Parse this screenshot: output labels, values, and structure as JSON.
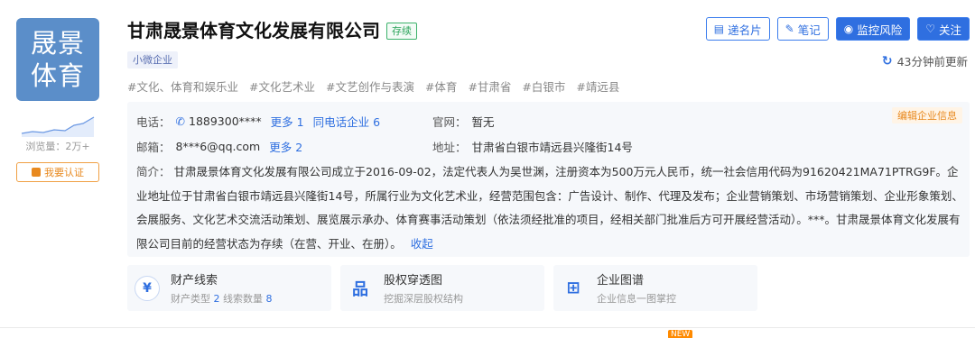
{
  "logo": {
    "line1": "晟景",
    "line2": "体育"
  },
  "sidebar": {
    "views_label": "浏览量：2万+",
    "claim_label": "我要认证"
  },
  "header": {
    "company_name": "甘肃晟景体育文化发展有限公司",
    "status": "存续",
    "size_tag": "小微企业",
    "industry_tags": [
      "#文化、体育和娱乐业",
      "#文化艺术业",
      "#文艺创作与表演",
      "#体育",
      "#甘肃省",
      "#白银市",
      "#靖远县"
    ]
  },
  "actions": {
    "card_label": "递名片",
    "note_label": "笔记",
    "monitor_label": "监控风险",
    "follow_label": "关注",
    "update_text": "43分钟前更新"
  },
  "info": {
    "edit_label": "编辑企业信息",
    "phone_label": "电话：",
    "phone": "1889300****",
    "phone_more": "更多 1",
    "phone_same": "同电话企业 6",
    "website_label": "官网：",
    "website": "暂无",
    "email_label": "邮箱：",
    "email": "8***6@qq.com",
    "email_more": "更多 2",
    "address_label": "地址：",
    "address": "甘肃省白银市靖远县兴隆街14号",
    "intro_label": "简介：",
    "intro_text": "甘肃晟景体育文化发展有限公司成立于2016-09-02，法定代表人为吴世渊，注册资本为500万元人民币，统一社会信用代码为91620421MA71PTRG9F。企业地址位于甘肃省白银市靖远县兴隆街14号，所属行业为文化艺术业，经营范围包含：广告设计、制作、代理及发布；企业营销策划、市场营销策划、企业形象策划、会展服务、文化艺术交流活动策划、展览展示承办、体育赛事活动策划（依法须经批准的项目，经相关部门批准后方可开展经营活动）。***。甘肃晟景体育文化发展有限公司目前的经营状态为存续（在营、开业、在册）。",
    "collapse_label": "收起"
  },
  "cards": {
    "assets": {
      "title": "财产线索",
      "sub_type_label": "财产类型",
      "sub_type_num": "2",
      "sub_count_label": "线索数量",
      "sub_count_num": "8"
    },
    "equity": {
      "title": "股权穿透图",
      "sub": "挖掘深层股权结构"
    },
    "graph": {
      "title": "企业图谱",
      "sub": "企业信息一图掌控"
    }
  },
  "footer": {
    "new_badge": "NEW"
  },
  "colors": {
    "accent": "#2f6fe0",
    "status_green": "#2ca45b",
    "orange": "#e8891f",
    "logo_bg": "#5b8ec9"
  }
}
